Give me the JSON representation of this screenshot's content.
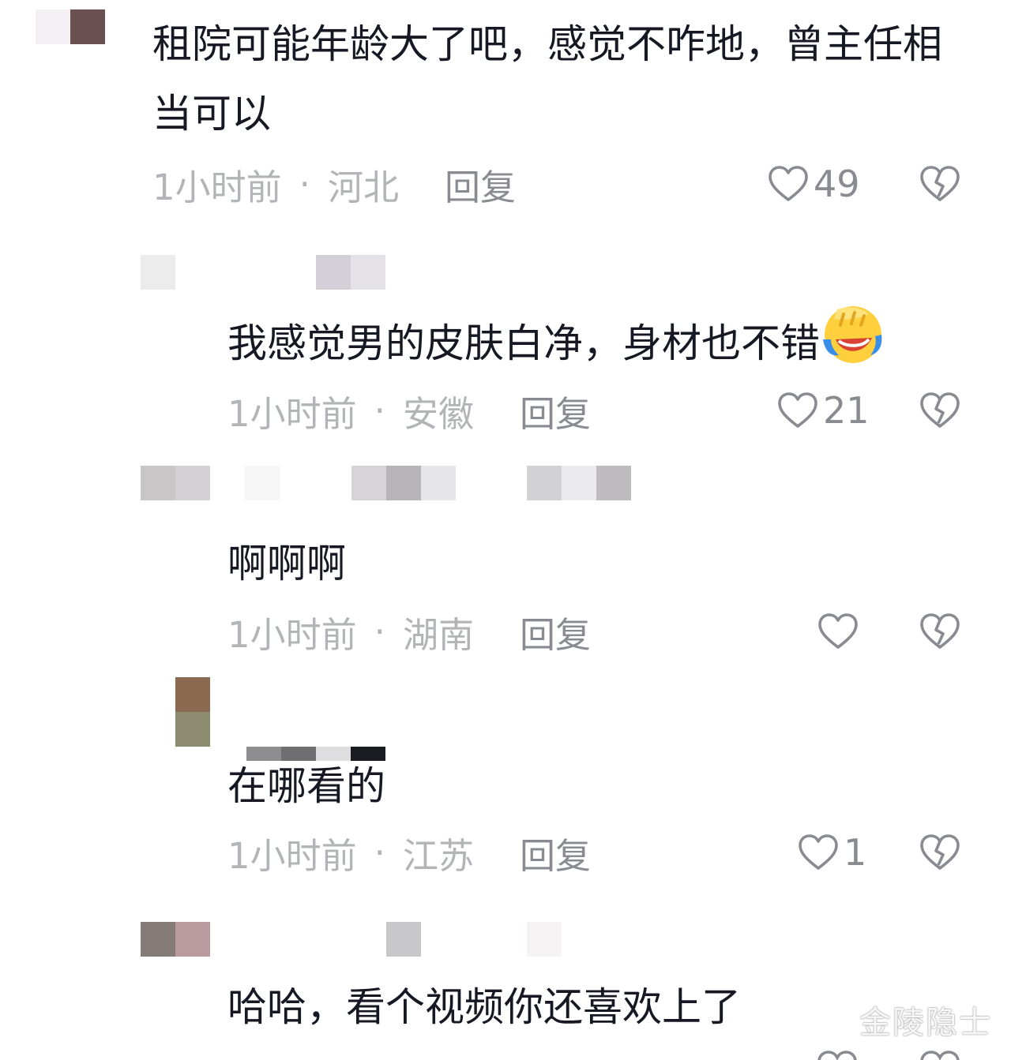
{
  "colors": {
    "text": "#161823",
    "meta": "#b3b4b7",
    "reply": "#8a8b91",
    "icon": "#8a8b91"
  },
  "comments": [
    {
      "text": "租院可能年龄大了吧，感觉不咋地，曾主任相当可以",
      "time": "1小时前",
      "sep": "·",
      "location": "河北",
      "reply": "回复",
      "likes": "49",
      "avatar_colors": [
        "#f4eff2",
        "#6b5052"
      ]
    },
    {
      "text": "我感觉男的皮肤白净，身材也不错",
      "emoji": "laughing-crying-emoji",
      "time": "1小时前",
      "sep": "·",
      "location": "安徽",
      "reply": "回复",
      "likes": "21",
      "name_colors": [
        "#ececec",
        "#d4d0d8",
        "#e4e2e7"
      ]
    },
    {
      "text": "啊啊啊",
      "time": "1小时前",
      "sep": "·",
      "location": "湖南",
      "reply": "回复",
      "likes": "",
      "name_colors": [
        "#c8c6c7",
        "#d3d1d3",
        "#f7f6f7",
        "#d6d4d6",
        "#b7b5b7",
        "#e6e5e7",
        "#d2d1d3",
        "#ebeaed",
        "#bdbbbe"
      ]
    },
    {
      "text": "在哪看的",
      "time": "1小时前",
      "sep": "·",
      "location": "江苏",
      "reply": "回复",
      "likes": "1",
      "avatar_colors": [
        "#8b6a52",
        "#8c8b6f"
      ],
      "name_colors": [
        "#8e8e90",
        "#6f6f72",
        "#dedde0",
        "#1b1b22"
      ]
    },
    {
      "text": "哈哈，看个视频你还喜欢上了",
      "name_colors": [
        "#857b78",
        "#b99b9f",
        "#c8c7c9",
        "#f6f3f5"
      ]
    }
  ],
  "watermark": "金陵隐士"
}
